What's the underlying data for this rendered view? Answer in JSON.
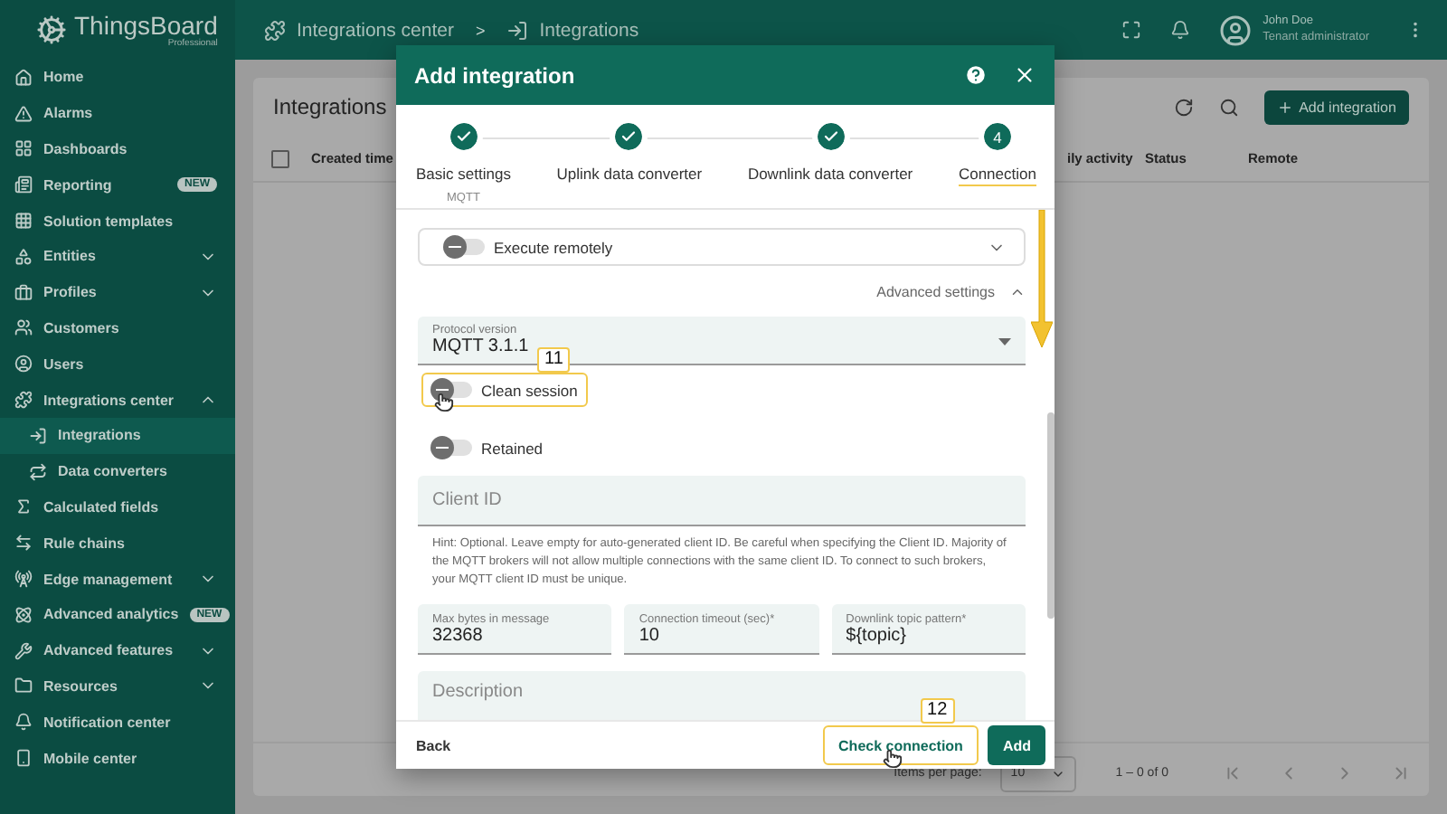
{
  "brand": {
    "name": "ThingsBoard",
    "edition": "Professional"
  },
  "sidebar": {
    "items": [
      {
        "label": "Home",
        "selected": false
      },
      {
        "label": "Alarms",
        "selected": false
      },
      {
        "label": "Dashboards",
        "selected": false
      },
      {
        "label": "Reporting",
        "selected": false,
        "badge": "NEW"
      },
      {
        "label": "Solution templates",
        "selected": false
      },
      {
        "label": "Entities",
        "selected": false,
        "expanded": false
      },
      {
        "label": "Profiles",
        "selected": false,
        "expanded": false
      },
      {
        "label": "Customers",
        "selected": false
      },
      {
        "label": "Users",
        "selected": false
      },
      {
        "label": "Integrations center",
        "selected": false,
        "expanded": true,
        "children": [
          {
            "label": "Integrations",
            "selected": true
          },
          {
            "label": "Data converters",
            "selected": false
          }
        ]
      },
      {
        "label": "Calculated fields",
        "selected": false
      },
      {
        "label": "Rule chains",
        "selected": false
      },
      {
        "label": "Edge management",
        "selected": false,
        "expanded": false
      },
      {
        "label": "Advanced analytics",
        "selected": false,
        "badge": "NEW"
      },
      {
        "label": "Advanced features",
        "selected": false,
        "expanded": false
      },
      {
        "label": "Resources",
        "selected": false,
        "expanded": false
      },
      {
        "label": "Notification center",
        "selected": false
      },
      {
        "label": "Mobile center",
        "selected": false
      }
    ]
  },
  "breadcrumb": {
    "items": [
      "Integrations center",
      "Integrations"
    ],
    "separator": ">"
  },
  "user": {
    "name": "John Doe",
    "role": "Tenant administrator"
  },
  "page": {
    "title": "Integrations",
    "add_button": "Add integration"
  },
  "table": {
    "select_all_checked": false,
    "columns": [
      "Created time",
      "ily activity",
      "Status",
      "Remote"
    ]
  },
  "pagination": {
    "items_per_page_label": "Items per page:",
    "page_size": "10",
    "range": "1 – 0 of 0"
  },
  "dialog": {
    "title": "Add integration",
    "steps": [
      {
        "label": "Basic settings",
        "sublabel": "MQTT",
        "completed": true,
        "selected": false
      },
      {
        "label": "Uplink data converter",
        "completed": true,
        "selected": false
      },
      {
        "label": "Downlink data converter",
        "completed": true,
        "selected": false
      },
      {
        "label": "Connection",
        "number": "4",
        "completed": false,
        "selected": true
      }
    ],
    "execute_remotely": {
      "label": "Execute remotely",
      "on": false,
      "expanded": false
    },
    "advanced_settings": {
      "label": "Advanced settings",
      "expanded": true
    },
    "protocol_version": {
      "label": "Protocol version",
      "value": "MQTT 3.1.1"
    },
    "toggles": [
      {
        "label": "Clean session",
        "on": false,
        "highlighted": true,
        "callout": "11"
      },
      {
        "label": "Retained",
        "on": false,
        "highlighted": false
      }
    ],
    "client_id": {
      "placeholder": "Client ID",
      "hint": "Hint: Optional. Leave empty for auto-generated client ID. Be careful when specifying the Client ID. Majority of the MQTT brokers will not allow multiple connections with the same client ID. To connect to such brokers, your MQTT client ID must be unique."
    },
    "fields": [
      {
        "label": "Max bytes in message",
        "value": "32368"
      },
      {
        "label": "Connection timeout (sec)*",
        "value": "10"
      },
      {
        "label": "Downlink topic pattern*",
        "value": "${topic}"
      }
    ],
    "description": {
      "placeholder": "Description"
    },
    "back_button": "Back",
    "check_button": {
      "label": "Check connection",
      "highlighted": true,
      "callout": "12"
    },
    "add_button": "Add"
  }
}
